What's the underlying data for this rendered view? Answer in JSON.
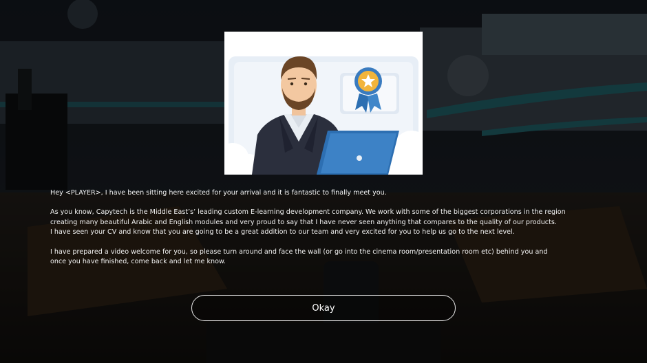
{
  "scene": {
    "background_description_colors": {
      "dark": "#0f1216",
      "accent_teal": "#2a6f7a",
      "wood": "#6b4a2c"
    }
  },
  "portrait": {
    "icon": "presenter-illustration",
    "badge_icon": "award-ribbon-star-icon",
    "laptop_icon": "laptop-icon"
  },
  "dialog": {
    "greeting": "Hey <PLAYER>, I have been sitting here excited for your arrival and it is fantastic to finally meet you.",
    "paragraph_2_line_1": "As you know, Capytech is the Middle East’s’ leading custom E-learning development company.  We work with some of the biggest corporations in the region",
    "paragraph_2_line_2": "creating many beautiful Arabic and English modules and very proud to say that I have never seen anything that compares to the quality of our products.",
    "paragraph_2_line_3": "I have seen your CV and know that you are going to be a great addition to our team and very excited for you to help us go to the next level.",
    "paragraph_3_line_1": "I have prepared a video welcome for you, so please turn around and face the wall (or go into the cinema room/presentation room etc) behind you and",
    "paragraph_3_line_2": "once you have finished, come back and let me know."
  },
  "actions": {
    "okay_label": "Okay"
  }
}
